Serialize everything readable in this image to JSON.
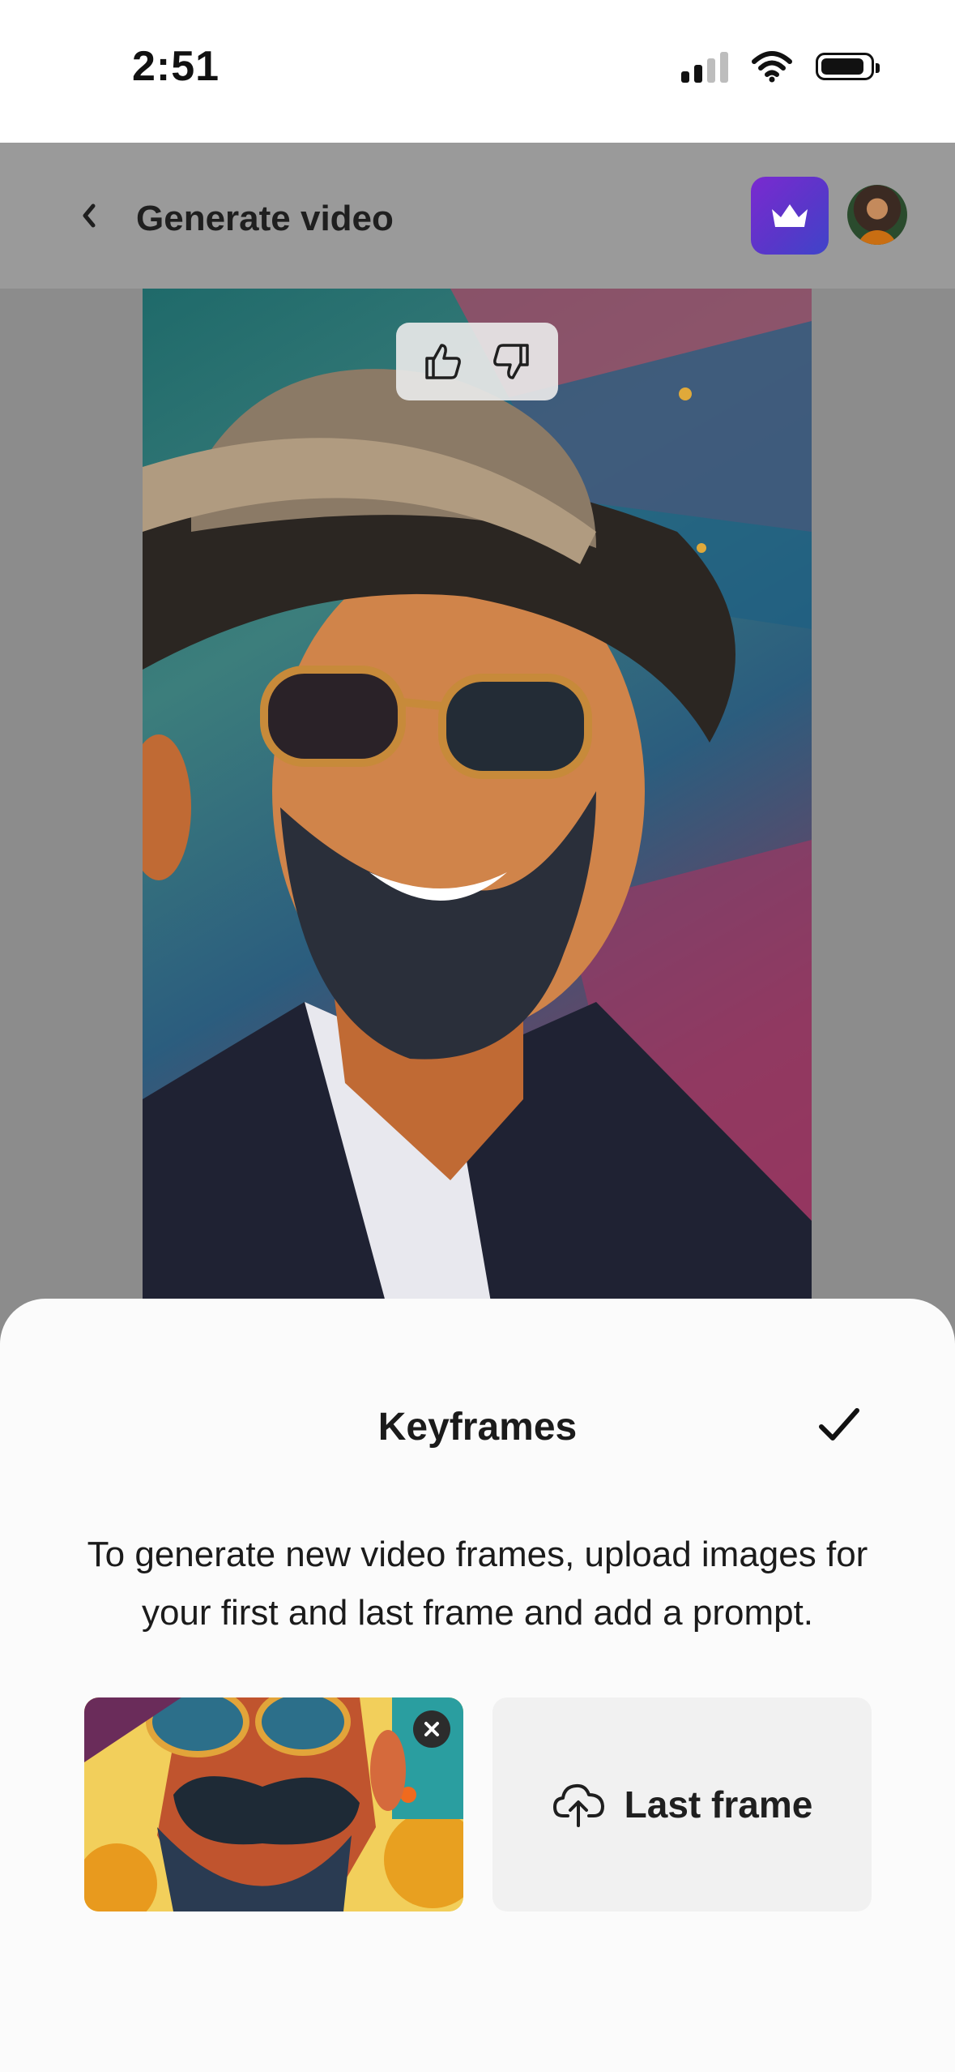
{
  "status_bar": {
    "time": "2:51"
  },
  "header": {
    "title": "Generate video"
  },
  "sheet": {
    "title": "Keyframes",
    "description": "To generate new video frames, upload images for your first and last frame and add a prompt.",
    "last_frame_label": "Last frame"
  },
  "icons": {
    "back": "chevron-left-icon",
    "premium": "crown-icon",
    "like": "thumbs-up-icon",
    "dislike": "thumbs-down-icon",
    "confirm": "checkmark-icon",
    "remove": "close-icon",
    "upload": "cloud-upload-icon"
  },
  "colors": {
    "premium_gradient_start": "#7a2ad0",
    "premium_gradient_end": "#3f44c9",
    "overlay_dim": "#8c8c8c",
    "sheet_background": "#fbfbfb",
    "upload_tile": "#f1f1f1"
  }
}
